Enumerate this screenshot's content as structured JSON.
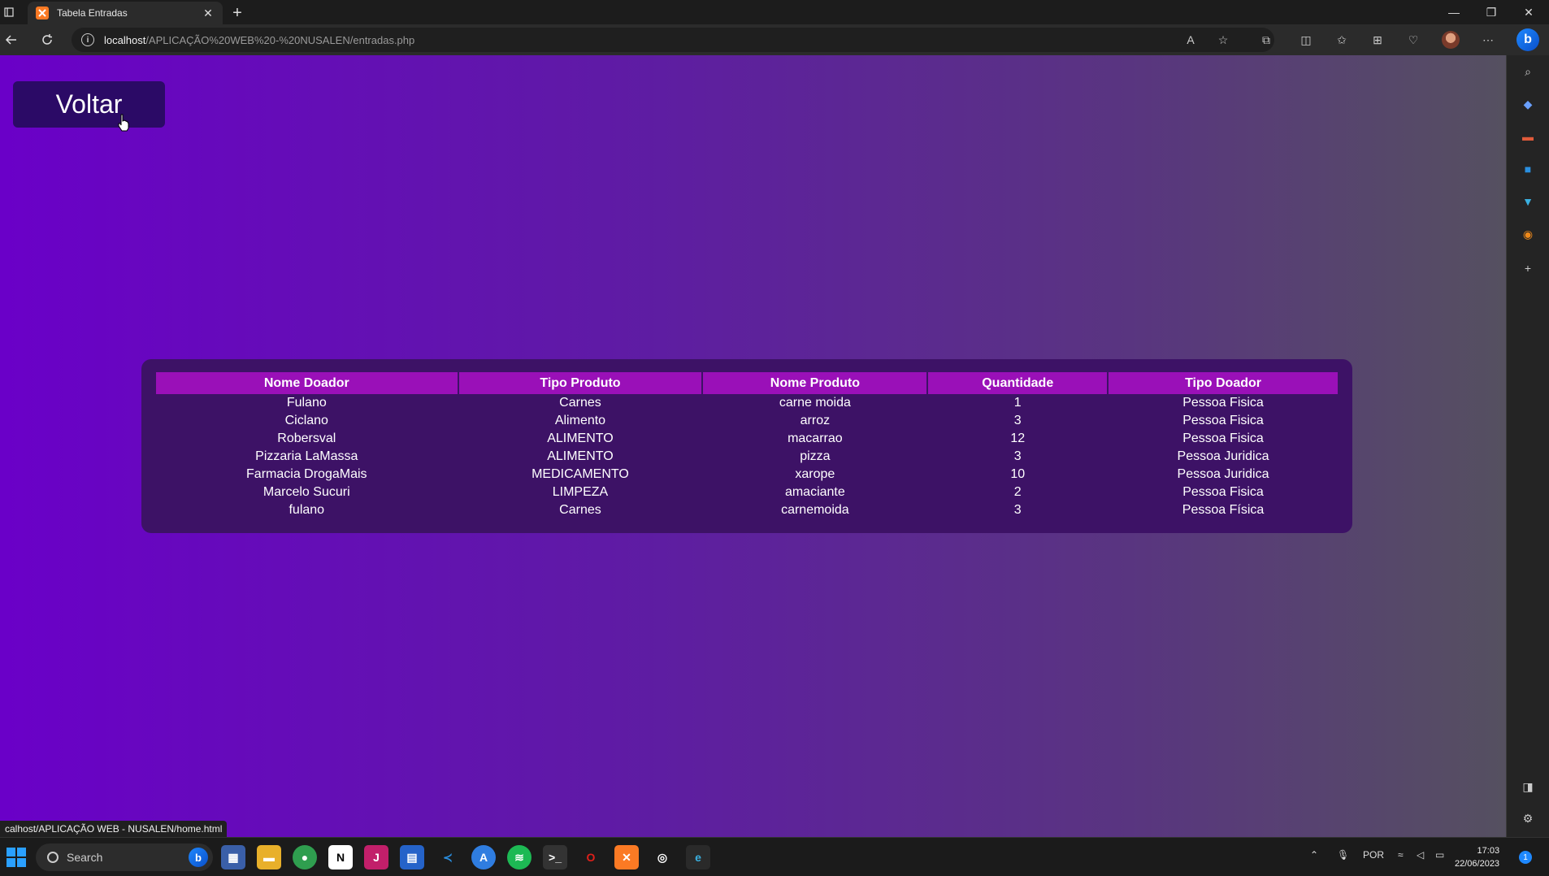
{
  "tab": {
    "title": "Tabela Entradas",
    "close": "✕"
  },
  "window": {
    "new_tab": "+",
    "minimize": "—",
    "restore": "❐",
    "close": "✕"
  },
  "address": {
    "host": "localhost",
    "path": "/APLICAÇÃO%20WEB%20-%20NUSALEN/entradas.php"
  },
  "page": {
    "back_button": "Voltar",
    "table": {
      "headers": [
        "Nome Doador",
        "Tipo Produto",
        "Nome Produto",
        "Quantidade",
        "Tipo Doador"
      ],
      "rows": [
        [
          "Fulano",
          "Carnes",
          "carne moida",
          "1",
          "Pessoa Fisica"
        ],
        [
          "Ciclano",
          "Alimento",
          "arroz",
          "3",
          "Pessoa Fisica"
        ],
        [
          "Robersval",
          "ALIMENTO",
          "macarrao",
          "12",
          "Pessoa Fisica"
        ],
        [
          "Pizzaria LaMassa",
          "ALIMENTO",
          "pizza",
          "3",
          "Pessoa Juridica"
        ],
        [
          "Farmacia DrogaMais",
          "MEDICAMENTO",
          "xarope",
          "10",
          "Pessoa Juridica"
        ],
        [
          "Marcelo Sucuri",
          "LIMPEZA",
          "amaciante",
          "2",
          "Pessoa Fisica"
        ],
        [
          "fulano",
          "Carnes",
          "carnemoida",
          "3",
          "Pessoa Física"
        ]
      ]
    }
  },
  "status_bar": "calhost/APLICAÇÃO WEB - NUSALEN/home.html",
  "taskbar": {
    "search_label": "Search",
    "language": "POR",
    "time": "17:03",
    "date": "22/06/2023",
    "notifications": "1"
  },
  "colors": {
    "header_cell": "#9a10b8",
    "table_bg": "#3d1266",
    "button_bg": "#2b0a66",
    "page_gradient_start": "#6a00c8",
    "page_gradient_end": "#555060"
  }
}
